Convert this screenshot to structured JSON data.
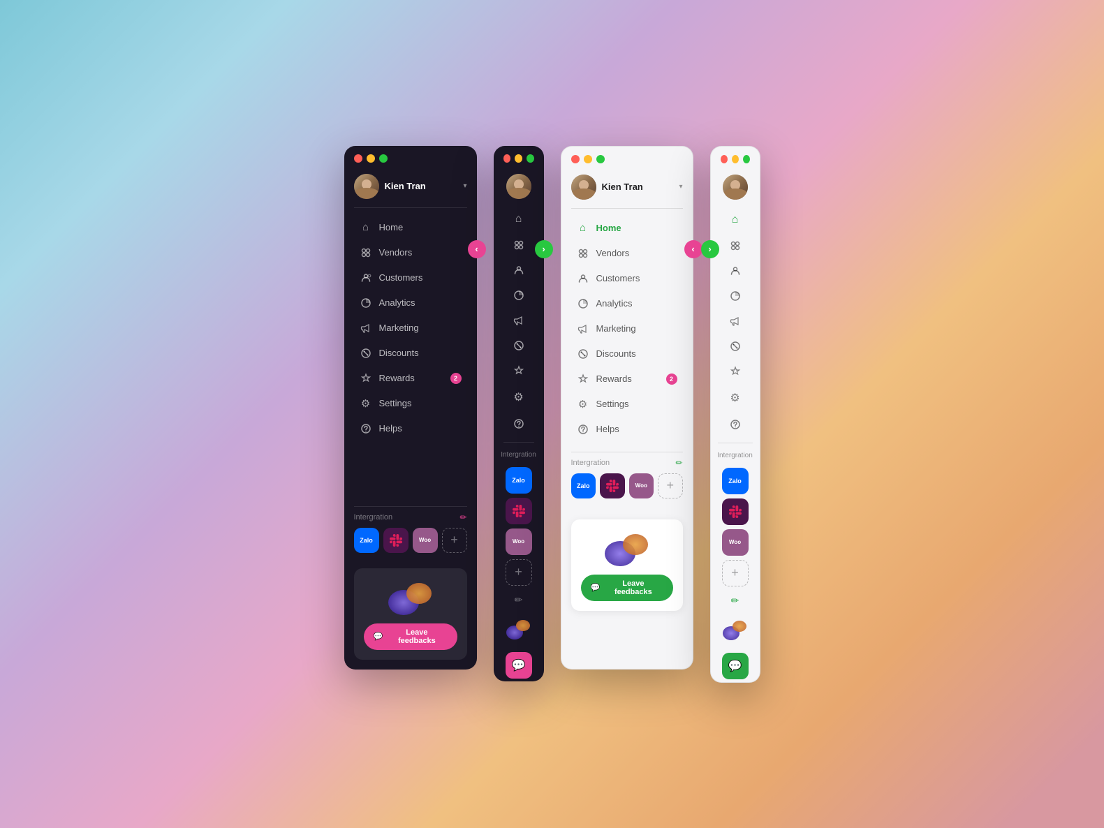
{
  "background": {
    "color_start": "#7ec8d8",
    "color_end": "#d898a0"
  },
  "sidebars": [
    {
      "id": "dark-expanded",
      "theme": "dark",
      "collapsed": false,
      "title_bar": {
        "dots": [
          "red",
          "yellow",
          "green"
        ]
      },
      "user": {
        "name": "Kien Tran",
        "dropdown": "▾"
      },
      "nav_arrow": {
        "direction": "left",
        "label": "‹"
      },
      "nav_items": [
        {
          "id": "home",
          "label": "Home",
          "icon": "⌂"
        },
        {
          "id": "vendors",
          "label": "Vendors",
          "icon": "⊞"
        },
        {
          "id": "customers",
          "label": "Customers",
          "icon": "⊙"
        },
        {
          "id": "analytics",
          "label": "Analytics",
          "icon": "◑"
        },
        {
          "id": "marketing",
          "label": "Marketing",
          "icon": "⊜"
        },
        {
          "id": "discounts",
          "label": "Discounts",
          "icon": "⊗"
        },
        {
          "id": "rewards",
          "label": "Rewards",
          "icon": "⊕",
          "badge": "2"
        },
        {
          "id": "settings",
          "label": "Settings",
          "icon": "⚙"
        },
        {
          "id": "helps",
          "label": "Helps",
          "icon": "?"
        }
      ],
      "integration": {
        "label": "Intergration",
        "edit_icon": "✏",
        "apps": [
          {
            "id": "zalo",
            "label": "Zalo",
            "color": "#0068ff"
          },
          {
            "id": "slack",
            "label": "Slack",
            "color": "#4a154b"
          },
          {
            "id": "woo",
            "label": "Woo",
            "color": "#96588a"
          }
        ],
        "add_label": "+"
      },
      "feedback": {
        "button_label": "Leave feedbacks",
        "button_icon": "💬"
      }
    },
    {
      "id": "dark-collapsed",
      "theme": "dark",
      "collapsed": true,
      "title_bar": {
        "dots": [
          "red",
          "yellow",
          "green"
        ]
      },
      "nav_arrow": {
        "direction": "right",
        "label": "›"
      },
      "integration": {
        "label": "Intergration",
        "apps": [
          {
            "id": "zalo",
            "label": "Zalo"
          },
          {
            "id": "slack",
            "label": "Slack"
          },
          {
            "id": "woo",
            "label": "Woo"
          }
        ],
        "add_label": "+"
      },
      "feedback": {
        "button_icon": "💬"
      }
    },
    {
      "id": "light-expanded",
      "theme": "light",
      "collapsed": false,
      "title_bar": {
        "dots": [
          "red",
          "yellow",
          "green"
        ]
      },
      "user": {
        "name": "Kien Tran",
        "dropdown": "▾"
      },
      "nav_arrow": {
        "direction": "left",
        "label": "‹"
      },
      "nav_items": [
        {
          "id": "home",
          "label": "Home",
          "icon": "⌂",
          "active": true
        },
        {
          "id": "vendors",
          "label": "Vendors",
          "icon": "⊞"
        },
        {
          "id": "customers",
          "label": "Customers",
          "icon": "⊙"
        },
        {
          "id": "analytics",
          "label": "Analytics",
          "icon": "◑"
        },
        {
          "id": "marketing",
          "label": "Marketing",
          "icon": "⊜"
        },
        {
          "id": "discounts",
          "label": "Discounts",
          "icon": "⊗"
        },
        {
          "id": "rewards",
          "label": "Rewards",
          "icon": "⊕",
          "badge": "2"
        },
        {
          "id": "settings",
          "label": "Settings",
          "icon": "⚙"
        },
        {
          "id": "helps",
          "label": "Helps",
          "icon": "?"
        }
      ],
      "integration": {
        "label": "Intergration",
        "edit_icon": "✏",
        "apps": [
          {
            "id": "zalo",
            "label": "Zalo"
          },
          {
            "id": "slack",
            "label": "Slack"
          },
          {
            "id": "woo",
            "label": "Woo"
          }
        ],
        "add_label": "+"
      },
      "feedback": {
        "button_label": "Leave feedbacks",
        "button_icon": "💬"
      }
    },
    {
      "id": "light-collapsed",
      "theme": "light",
      "collapsed": true,
      "title_bar": {
        "dots": [
          "red",
          "yellow",
          "green"
        ]
      },
      "nav_arrow": {
        "direction": "right",
        "label": "›"
      },
      "integration": {
        "label": "Intergration",
        "apps": [
          {
            "id": "zalo",
            "label": "Zalo"
          },
          {
            "id": "slack",
            "label": "Slack"
          },
          {
            "id": "woo",
            "label": "Woo"
          }
        ],
        "add_label": "+"
      },
      "feedback": {
        "button_icon": "💬"
      }
    }
  ]
}
